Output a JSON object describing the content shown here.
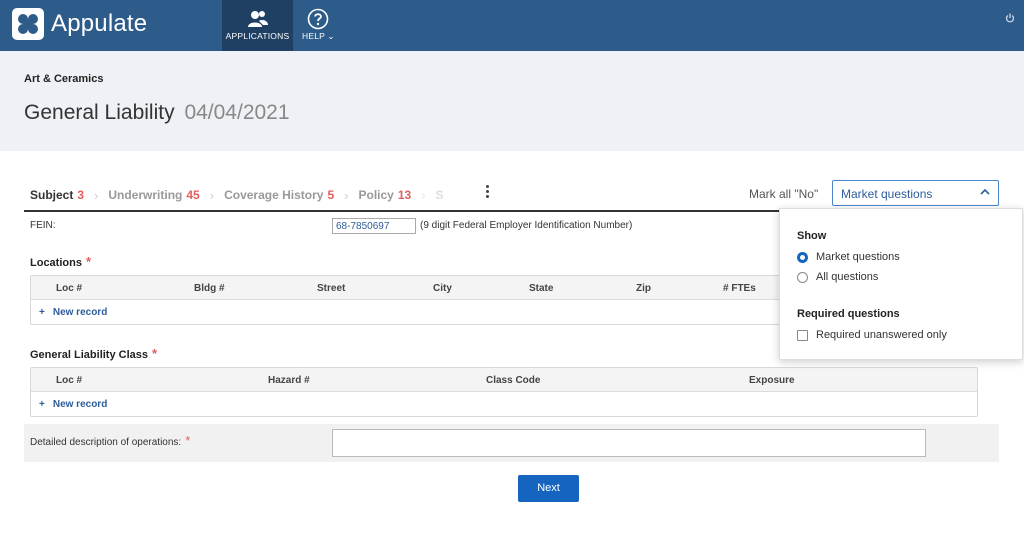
{
  "app": {
    "name": "Appulate"
  },
  "nav": {
    "applications": "APPLICATIONS",
    "help": "HELP",
    "help_caret": "⌄"
  },
  "header": {
    "subtitle": "Art & Ceramics",
    "title": "General Liability",
    "date": "04/04/2021"
  },
  "steps": [
    {
      "label": "Subject",
      "count": "3"
    },
    {
      "label": "Underwriting",
      "count": "45"
    },
    {
      "label": "Coverage History",
      "count": "5"
    },
    {
      "label": "Policy",
      "count": "13"
    },
    {
      "label": "S",
      "count": ""
    }
  ],
  "toolbar": {
    "mark_all": "Mark all \"No\"",
    "market_select": "Market questions"
  },
  "form": {
    "fein_label": "FEIN:",
    "fein_value": "68-7850697",
    "fein_hint": "(9 digit Federal Employer Identification Number)",
    "locations": {
      "title": "Locations",
      "columns": [
        "Loc #",
        "Bldg #",
        "Street",
        "City",
        "State",
        "Zip",
        "# FTEs"
      ],
      "new_record": "New record"
    },
    "gl_class": {
      "title": "General Liability Class",
      "columns": [
        "Loc #",
        "Hazard #",
        "Class Code",
        "Exposure"
      ],
      "new_record": "New record"
    },
    "description_label": "Detailed description of operations:",
    "required_mark": "*",
    "next_button": "Next"
  },
  "popup": {
    "show_heading": "Show",
    "options": [
      {
        "label": "Market questions",
        "selected": true
      },
      {
        "label": "All questions",
        "selected": false
      }
    ],
    "required_heading": "Required questions",
    "required_option": {
      "label": "Required unanswered only",
      "checked": false
    }
  },
  "colors": {
    "topbar": "#2e5c8a",
    "accent": "#1565c0",
    "required": "#e35d5d"
  }
}
